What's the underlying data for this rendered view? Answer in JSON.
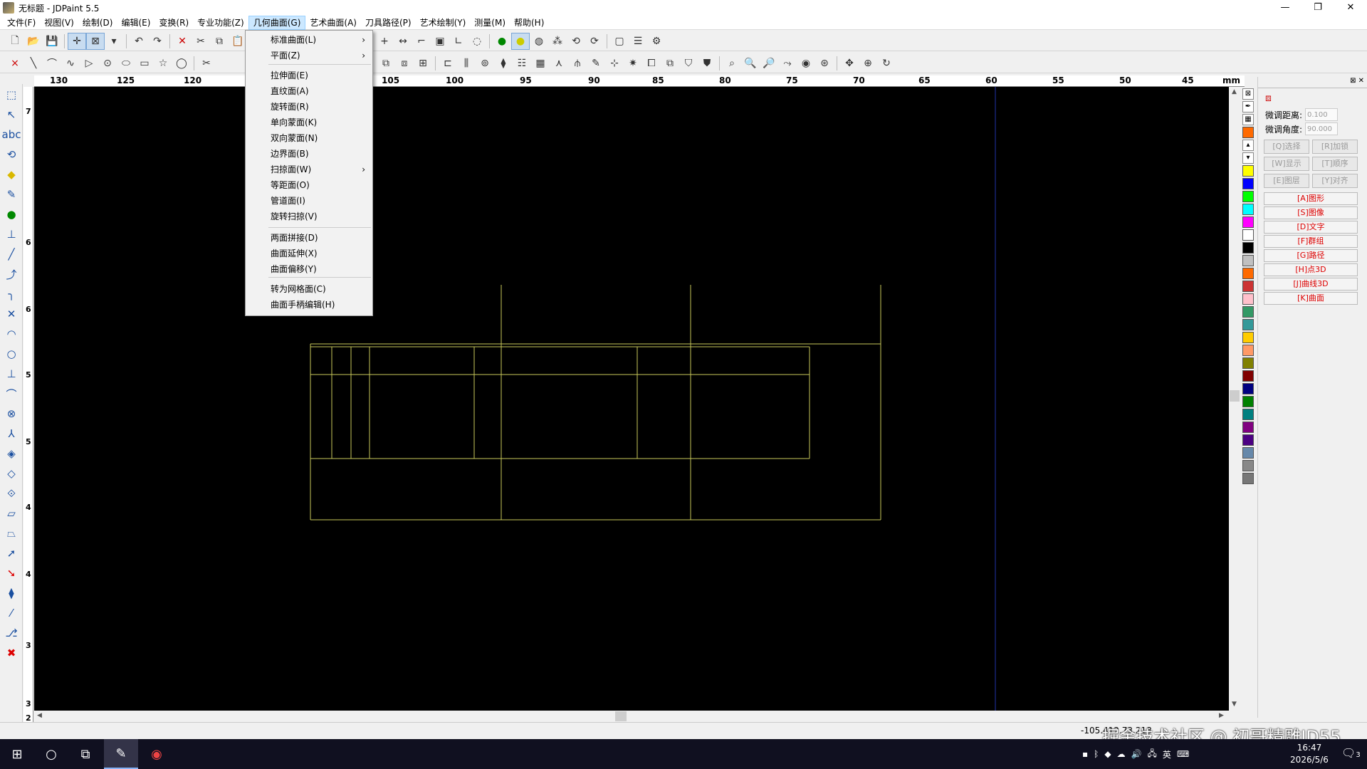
{
  "window": {
    "title": "无标题 - JDPaint 5.5",
    "minimize": "—",
    "maximize": "❐",
    "close": "✕"
  },
  "menubar": [
    "文件(F)",
    "视图(V)",
    "绘制(D)",
    "编辑(E)",
    "变换(R)",
    "专业功能(Z)",
    "几何曲面(G)",
    "艺术曲面(A)",
    "刀具路径(P)",
    "艺术绘制(Y)",
    "测量(M)",
    "帮助(H)"
  ],
  "active_menu": "几何曲面(G)",
  "dropdown": {
    "items": [
      {
        "label": "标准曲面(L)",
        "submenu": true
      },
      {
        "label": "平面(Z)",
        "submenu": true
      },
      {
        "label": "拉伸面(E)"
      },
      {
        "label": "直纹面(A)"
      },
      {
        "label": "旋转面(R)"
      },
      {
        "label": "单向蒙面(K)"
      },
      {
        "label": "双向蒙面(N)"
      },
      {
        "label": "边界面(B)"
      },
      {
        "label": "扫掠面(W)",
        "submenu": true
      },
      {
        "label": "等距面(O)"
      },
      {
        "label": "管道面(I)"
      },
      {
        "label": "旋转扫掠(V)"
      },
      {
        "label": "两面拼接(D)"
      },
      {
        "label": "曲面延伸(X)"
      },
      {
        "label": "曲面偏移(Y)"
      },
      {
        "label": "转为网格面(C)"
      },
      {
        "label": "曲面手柄编辑(H)"
      }
    ],
    "submenu_arrow": "›"
  },
  "ruler": {
    "ticks": [
      "130",
      "125",
      "120",
      "105",
      "100",
      "95",
      "90",
      "85",
      "80",
      "75",
      "70",
      "65",
      "60",
      "55",
      "50",
      "45"
    ],
    "unit": "mm"
  },
  "vruler": {
    "labels": [
      "7",
      "6",
      "6",
      "5",
      "5",
      "4",
      "4",
      "3",
      "3",
      "2",
      "2"
    ]
  },
  "right_panel": {
    "fine_distance_label": "微调距离:",
    "fine_distance_value": "0.100",
    "fine_angle_label": "微调角度:",
    "fine_angle_value": "90.000",
    "grid_buttons": [
      "[Q]选择",
      "[R]加锁",
      "[W]显示",
      "[T]顺序",
      "[E]图层",
      "[Y]对齐"
    ],
    "filter_buttons": [
      "[A]图形",
      "[S]图像",
      "[D]文字",
      "[F]群组",
      "[G]路径",
      "[H]点3D",
      "[J]曲线3D",
      "[K]曲面"
    ]
  },
  "palette_colors": [
    "#ffff00",
    "#0000ff",
    "#00ff00",
    "#00ffff",
    "#ff00ff",
    "#ffffff",
    "#000000",
    "#c0c0c0",
    "#ff6a00",
    "#cc3333",
    "#ffc0cb",
    "#339966",
    "#339999",
    "#ffcc00",
    "#ff9966",
    "#808000",
    "#800000",
    "#000080",
    "#008000",
    "#008080",
    "#800080",
    "#4b0082",
    "#6688aa",
    "#888888",
    "#777777"
  ],
  "status": {
    "coords": "-105.412,73.218",
    "watermark": "掘金技术社区 @ 初哥精雕JD55"
  },
  "taskbar": {
    "start": "⊞",
    "search": "○",
    "taskview": "⧉",
    "lang": "英",
    "time": "16:47",
    "date": "2026/5/6",
    "notif_count": "3"
  },
  "drawing": {
    "line_color": "#c8c85a"
  }
}
